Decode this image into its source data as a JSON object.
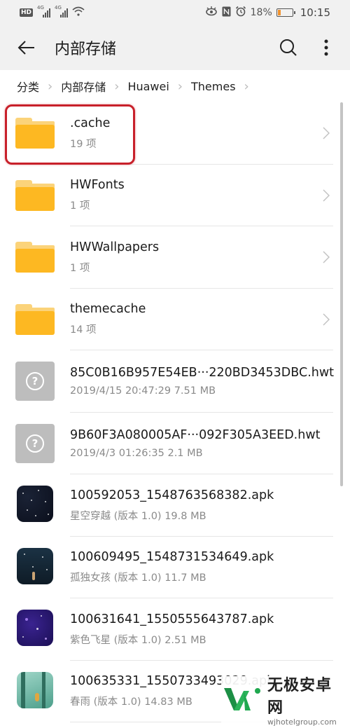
{
  "status_bar": {
    "hd_label": "HD",
    "sim1_label": "4G",
    "sim2_label": "4G",
    "battery_percent": "18%",
    "battery_level": 0.18,
    "time": "10:15",
    "icons": [
      "hd-icon",
      "signal-icon",
      "signal-icon",
      "wifi-icon",
      "eye-comfort-icon",
      "nfc-icon",
      "alarm-icon",
      "battery-icon"
    ]
  },
  "app_bar": {
    "title": "内部存储",
    "back_icon": "arrow-left-icon",
    "search_icon": "search-icon",
    "more_icon": "more-vertical-icon"
  },
  "breadcrumb": {
    "items": [
      "分类",
      "内部存储",
      "Huawei",
      "Themes"
    ]
  },
  "files": [
    {
      "type": "folder",
      "name": ".cache",
      "meta": "19 项",
      "highlighted": true
    },
    {
      "type": "folder",
      "name": "HWFonts",
      "meta": "1 项"
    },
    {
      "type": "folder",
      "name": "HWWallpapers",
      "meta": "1 项"
    },
    {
      "type": "folder",
      "name": "themecache",
      "meta": "14 项"
    },
    {
      "type": "unknown",
      "name": "85C0B16B957E54EB···220BD3453DBC.hwt",
      "meta": "2019/4/15 20:47:29 7.51 MB"
    },
    {
      "type": "unknown",
      "name": "9B60F3A080005AF···092F305A3EED.hwt",
      "meta": "2019/4/3 01:26:35 2.1 MB"
    },
    {
      "type": "apk",
      "name": "100592053_1548763568382.apk",
      "meta": "星空穿越 (版本 1.0) 19.8 MB"
    },
    {
      "type": "apk",
      "name": "100609495_1548731534649.apk",
      "meta": "孤独女孩 (版本 1.0) 11.7 MB"
    },
    {
      "type": "apk",
      "name": "100631641_1550555643787.apk",
      "meta": "紫色飞星 (版本 1.0) 2.51 MB"
    },
    {
      "type": "apk",
      "name": "100635331_1550733493029.apk",
      "meta": "春雨 (版本 1.0) 14.83 MB"
    }
  ],
  "watermark": {
    "title": "无极安卓网",
    "url": "wjhotelgroup.com"
  },
  "colors": {
    "folder": "#fdb822",
    "highlight": "#c8202a",
    "watermark_green": "#1fa84f"
  }
}
